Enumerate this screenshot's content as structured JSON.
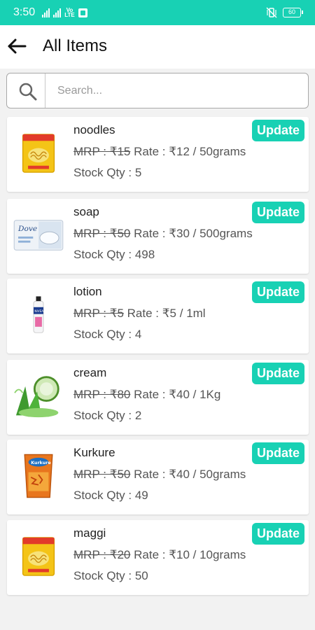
{
  "status_bar": {
    "time": "3:50",
    "network_label": "Vo LTE",
    "battery": "60"
  },
  "header": {
    "title": "All Items"
  },
  "search": {
    "placeholder": "Search..."
  },
  "colors": {
    "accent": "#18d1b4"
  },
  "items": [
    {
      "name": "noodles",
      "mrp": "MRP : ₹15",
      "rate": "Rate : ₹12",
      "unit": "/ 50grams",
      "stock": "Stock Qty : 5",
      "update_label": "Update",
      "thumbnail": "noodles-pack"
    },
    {
      "name": "soap",
      "mrp": "MRP : ₹50",
      "rate": "Rate : ₹30",
      "unit": "/ 500grams",
      "stock": "Stock Qty : 498",
      "update_label": "Update",
      "thumbnail": "soap-box"
    },
    {
      "name": "lotion",
      "mrp": "MRP : ₹5",
      "rate": "Rate : ₹5",
      "unit": "/ 1ml",
      "stock": "Stock Qty : 4",
      "update_label": "Update",
      "thumbnail": "lotion-bottle"
    },
    {
      "name": "cream",
      "mrp": "MRP : ₹80",
      "rate": "Rate : ₹40",
      "unit": "/ 1Kg",
      "stock": "Stock Qty : 2",
      "update_label": "Update",
      "thumbnail": "aloe-cucumber"
    },
    {
      "name": "Kurkure",
      "mrp": "MRP : ₹50",
      "rate": "Rate : ₹40",
      "unit": "/ 50grams",
      "stock": "Stock Qty : 49",
      "update_label": "Update",
      "thumbnail": "snack-pack"
    },
    {
      "name": "maggi",
      "mrp": "MRP : ₹20",
      "rate": "Rate : ₹10",
      "unit": "/ 10grams",
      "stock": "Stock Qty : 50",
      "update_label": "Update",
      "thumbnail": "noodles-pack"
    }
  ]
}
